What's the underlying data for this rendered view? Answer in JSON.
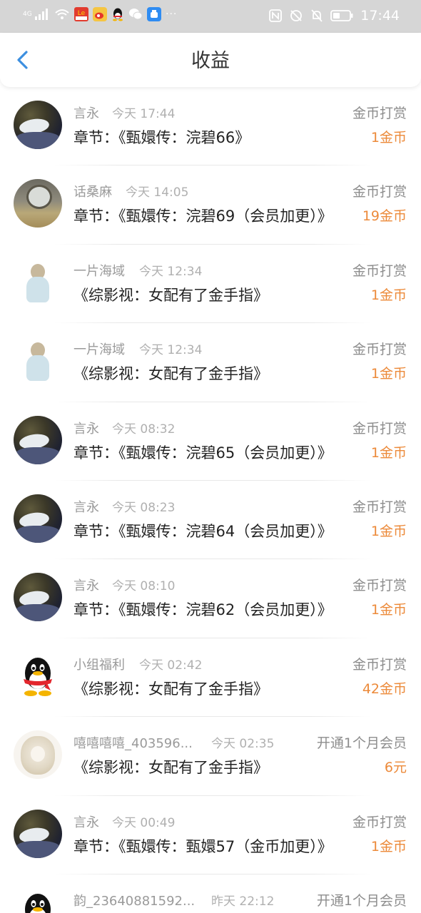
{
  "status_bar": {
    "network": "4G",
    "time": "17:44",
    "more": "···"
  },
  "header": {
    "title": "收益"
  },
  "records": [
    {
      "name": "言永",
      "time": "今天 17:44",
      "type": "金币打赏",
      "desc": "章节：《甄嬛传：浣碧66》",
      "amount": "1金币",
      "avatar": "cat"
    },
    {
      "name": "话桑麻",
      "time": "今天 14:05",
      "type": "金币打赏",
      "desc": "章节：《甄嬛传：浣碧69（会员加更）》",
      "amount": "19金币",
      "avatar": "room"
    },
    {
      "name": "一片海域",
      "time": "今天 12:34",
      "type": "金币打赏",
      "desc": "《综影视：女配有了金手指》",
      "amount": "1金币",
      "avatar": "girl"
    },
    {
      "name": "一片海域",
      "time": "今天 12:34",
      "type": "金币打赏",
      "desc": "《综影视：女配有了金手指》",
      "amount": "1金币",
      "avatar": "girl"
    },
    {
      "name": "言永",
      "time": "今天 08:32",
      "type": "金币打赏",
      "desc": "章节：《甄嬛传：浣碧65（会员加更）》",
      "amount": "1金币",
      "avatar": "cat"
    },
    {
      "name": "言永",
      "time": "今天 08:23",
      "type": "金币打赏",
      "desc": "章节：《甄嬛传：浣碧64（会员加更）》",
      "amount": "1金币",
      "avatar": "cat"
    },
    {
      "name": "言永",
      "time": "今天 08:10",
      "type": "金币打赏",
      "desc": "章节：《甄嬛传：浣碧62（会员加更）》",
      "amount": "1金币",
      "avatar": "cat"
    },
    {
      "name": "小组福利",
      "time": "今天 02:42",
      "type": "金币打赏",
      "desc": "《综影视：女配有了金手指》",
      "amount": "42金币",
      "avatar": "qq"
    },
    {
      "name": "嘻嘻嘻嘻_403596...",
      "time": "今天 02:35",
      "type": "开通1个月会员",
      "desc": "《综影视：女配有了金手指》",
      "amount": "6元",
      "avatar": "sketch"
    },
    {
      "name": "言永",
      "time": "今天 00:49",
      "type": "金币打赏",
      "desc": "章节：《甄嬛传：甄嬛57（金币加更）》",
      "amount": "1金币",
      "avatar": "cat"
    },
    {
      "name": "韵_23640881592...",
      "time": "昨天 22:12",
      "type": "开通1个月会员",
      "desc": "",
      "amount": "",
      "avatar": "qq"
    }
  ],
  "icons": {
    "back": "chevron-left-icon",
    "accent": "#3d8fe0",
    "amount_color": "#ec8a3a"
  }
}
